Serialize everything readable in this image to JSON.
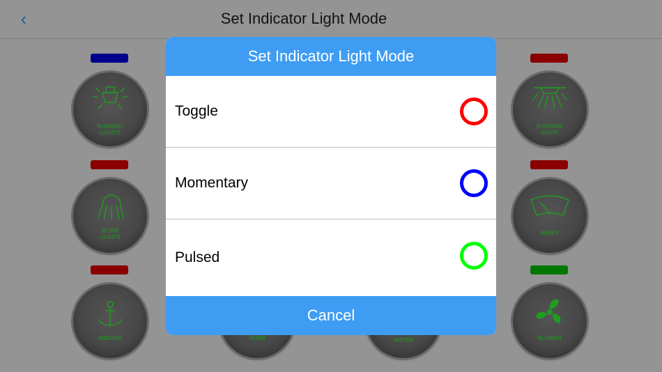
{
  "nav": {
    "back_icon": "chevron-left-icon",
    "title": "Set Indicator Light Mode"
  },
  "panel": {
    "switches": [
      {
        "id": "running-lights",
        "label_lines": [
          "RUNNING",
          "LIGHTS"
        ],
        "indicator_color": "#0000b8",
        "icon": "running-light-icon"
      },
      {
        "id": "interior-light",
        "label_lines": [
          "INTERIOR",
          "LIGHT"
        ],
        "indicator_color": "#b80000",
        "icon": "interior-light-icon"
      },
      {
        "id": "work-lights",
        "label_lines": [
          "WORK",
          "LIGHTS"
        ],
        "indicator_color": "#b80000",
        "icon": "work-light-icon"
      },
      {
        "id": "wiper",
        "label_lines": [
          "WIPER"
        ],
        "indicator_color": "#b80000",
        "icon": "wiper-icon"
      },
      {
        "id": "anchor",
        "label_lines": [
          "ANCHOR"
        ],
        "indicator_color": "#b80000",
        "icon": "anchor-icon"
      },
      {
        "id": "horn",
        "label_lines": [
          "HORN"
        ],
        "icon": "horn-icon"
      },
      {
        "id": "water",
        "label_lines": [
          "WATER"
        ],
        "icon": "water-icon"
      },
      {
        "id": "blower",
        "label_lines": [
          "BLOWER"
        ],
        "indicator_color": "#00a000",
        "icon": "fan-icon"
      }
    ]
  },
  "modal": {
    "title": "Set Indicator Light Mode",
    "options": [
      {
        "label": "Toggle",
        "color": "#ff0000"
      },
      {
        "label": "Momentary",
        "color": "#0000ff"
      },
      {
        "label": "Pulsed",
        "color": "#00ff00"
      }
    ],
    "cancel_label": "Cancel",
    "accent_color": "#3e9cf3"
  }
}
